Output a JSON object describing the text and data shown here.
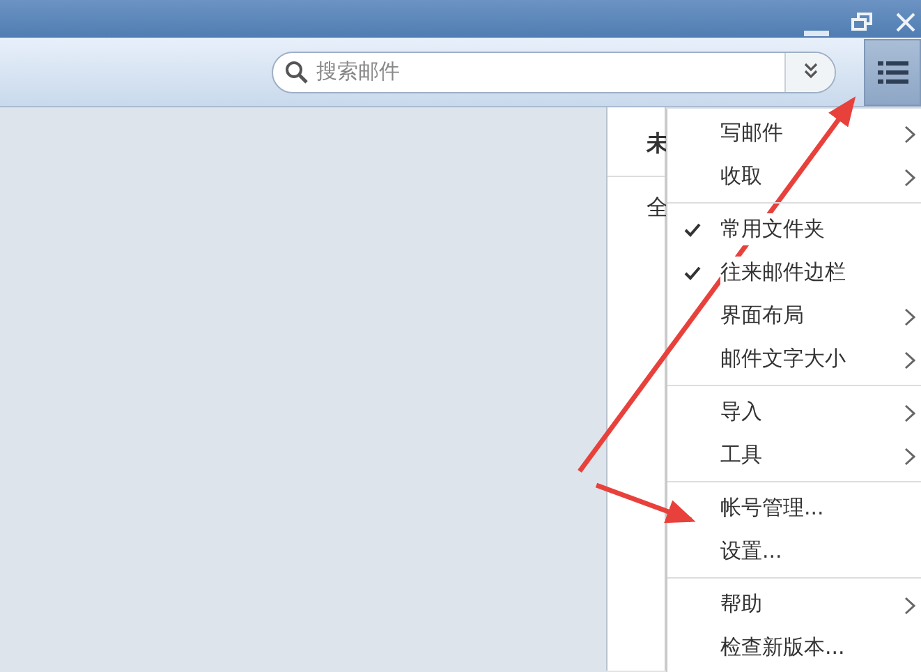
{
  "search": {
    "placeholder": "搜索邮件"
  },
  "list_pane": {
    "column_1": "未",
    "row_1": "全"
  },
  "menu": {
    "groups": [
      [
        {
          "label": "写邮件",
          "checked": false,
          "submenu": true
        },
        {
          "label": "收取",
          "checked": false,
          "submenu": true
        }
      ],
      [
        {
          "label": "常用文件夹",
          "checked": true,
          "submenu": false
        },
        {
          "label": "往来邮件边栏",
          "checked": true,
          "submenu": false
        },
        {
          "label": "界面布局",
          "checked": false,
          "submenu": true
        },
        {
          "label": "邮件文字大小",
          "checked": false,
          "submenu": true
        }
      ],
      [
        {
          "label": "导入",
          "checked": false,
          "submenu": true
        },
        {
          "label": "工具",
          "checked": false,
          "submenu": true
        }
      ],
      [
        {
          "label": "帐号管理...",
          "checked": false,
          "submenu": false
        },
        {
          "label": "设置...",
          "checked": false,
          "submenu": false
        }
      ],
      [
        {
          "label": "帮助",
          "checked": false,
          "submenu": true
        },
        {
          "label": "检查新版本...",
          "checked": false,
          "submenu": false
        }
      ]
    ]
  }
}
